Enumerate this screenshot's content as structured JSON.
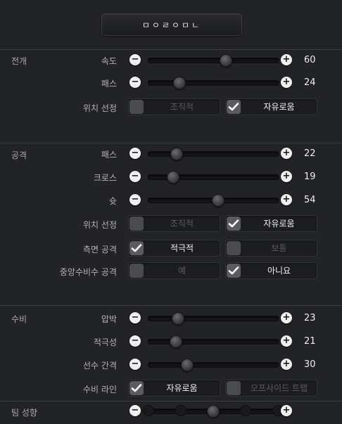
{
  "header": {
    "button_label": "ㅁㅇㄹㅇㅁㄴ"
  },
  "sections": {
    "build": {
      "title": "전개",
      "speed": {
        "label": "속도",
        "value": "60",
        "level": 0.6
      },
      "passing": {
        "label": "패스",
        "value": "24",
        "level": 0.24
      },
      "positioning": {
        "label": "위치 선정",
        "opt1": "조직적",
        "opt2": "자유로움"
      }
    },
    "attack": {
      "title": "공격",
      "passing": {
        "label": "패스",
        "value": "22",
        "level": 0.22
      },
      "crossing": {
        "label": "크로스",
        "value": "19",
        "level": 0.19
      },
      "shooting": {
        "label": "슛",
        "value": "54",
        "level": 0.54
      },
      "positioning": {
        "label": "위치 선정",
        "opt1": "조직적",
        "opt2": "자유로움"
      },
      "wide": {
        "label": "측면 공격",
        "opt1": "적극적",
        "opt2": "보통"
      },
      "cdm": {
        "label": "중앙수비수 공격",
        "opt1": "예",
        "opt2": "아니요"
      }
    },
    "defense": {
      "title": "수비",
      "pressure": {
        "label": "압박",
        "value": "23",
        "level": 0.23
      },
      "aggression": {
        "label": "적극성",
        "value": "21",
        "level": 0.21
      },
      "width": {
        "label": "선수 간격",
        "value": "30",
        "level": 0.3
      },
      "line": {
        "label": "수비 라인",
        "opt1": "자유로움",
        "opt2": "오프사이드 트랩"
      }
    },
    "team": {
      "title": "팀 성향",
      "level": 0.5
    }
  },
  "icons": {
    "minus": "−",
    "plus": "+",
    "check": "check-icon"
  }
}
